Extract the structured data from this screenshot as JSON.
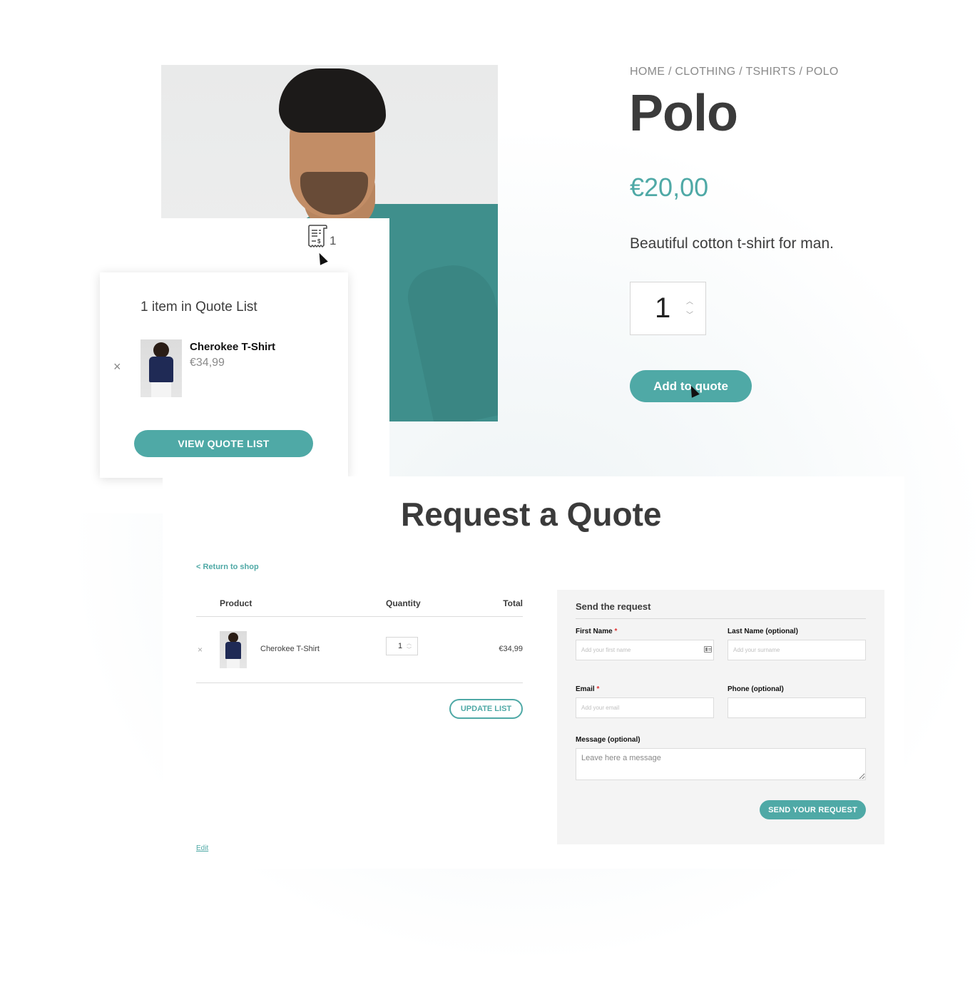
{
  "colors": {
    "accent": "#4fa9a6",
    "text_dark": "#3b3b3b",
    "muted": "#8a8a8a",
    "required": "#e03131",
    "form_bg": "#f4f4f4"
  },
  "product": {
    "breadcrumb": "HOME / CLOTHING / TSHIRTS / POLO",
    "title": "Polo",
    "price": "€20,00",
    "description": "Beautiful cotton t-shirt for man.",
    "quantity": "1",
    "add_to_quote_label": "Add to quote",
    "image_alt": "Man wearing teal polo shirt"
  },
  "mini_cart": {
    "icon": "quote-receipt-icon",
    "count": "1",
    "heading": "1 item in Quote List",
    "remove_symbol": "×",
    "items": [
      {
        "name": "Cherokee T-Shirt",
        "price": "€34,99"
      }
    ],
    "view_button_label": "VIEW QUOTE LIST"
  },
  "request_quote": {
    "title": "Request a Quote",
    "return_link": "< Return to shop",
    "table": {
      "headers": {
        "product": "Product",
        "quantity": "Quantity",
        "total": "Total"
      },
      "rows": [
        {
          "remove": "×",
          "name": "Cherokee T-Shirt",
          "quantity": "1",
          "total": "€34,99"
        }
      ]
    },
    "update_button_label": "UPDATE LIST",
    "edit_link": "Edit"
  },
  "form": {
    "title": "Send the request",
    "required_mark": "*",
    "first_name": {
      "label": "First Name",
      "placeholder": "Add your first name",
      "value": ""
    },
    "last_name": {
      "label": "Last Name (optional)",
      "placeholder": "Add your surname",
      "value": ""
    },
    "email": {
      "label": "Email",
      "placeholder": "Add your email",
      "value": ""
    },
    "phone": {
      "label": "Phone (optional)",
      "placeholder": "",
      "value": ""
    },
    "message": {
      "label": "Message (optional)",
      "placeholder": "Leave here a message",
      "value": ""
    },
    "submit_label": "SEND YOUR REQUEST"
  }
}
